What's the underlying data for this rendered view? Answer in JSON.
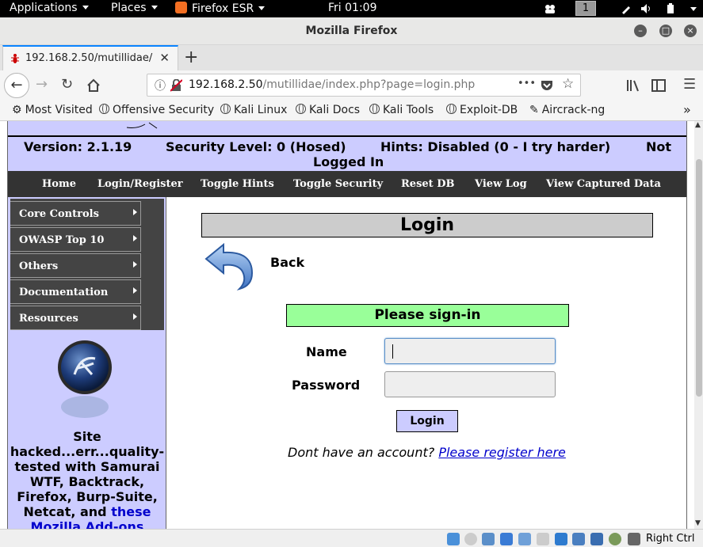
{
  "topbar": {
    "applications": "Applications",
    "places": "Places",
    "firefox": "Firefox ESR",
    "clock": "Fri 01:09",
    "workspace": "1"
  },
  "window": {
    "title": "Mozilla Firefox"
  },
  "tab": {
    "label": "192.168.2.50/mutillidae/"
  },
  "urlbar": {
    "host": "192.168.2.50",
    "path": "/mutillidae/index.php?page=login.php",
    "ellipsis": "•••"
  },
  "bookmarks": [
    "Most Visited",
    "Offensive Security",
    "Kali Linux",
    "Kali Docs",
    "Kali Tools",
    "Exploit-DB",
    "Aircrack-ng"
  ],
  "page": {
    "version": "Version: 2.1.19",
    "security": "Security Level: 0 (Hosed)",
    "hints": "Hints: Disabled (0 - I try harder)",
    "not": "Not",
    "logged_in": "Logged In",
    "menu": [
      "Home",
      "Login/Register",
      "Toggle Hints",
      "Toggle Security",
      "Reset DB",
      "View Log",
      "View Captured Data"
    ],
    "side_menu": [
      "Core Controls",
      "OWASP Top 10",
      "Others",
      "Documentation",
      "Resources"
    ],
    "side_text": [
      "Site",
      "hacked...err...quality-",
      "tested with Samurai",
      "WTF, Backtrack,",
      "Firefox, Burp-Suite,",
      "Netcat, and "
    ],
    "side_link": "these",
    "side_link2": "Mozilla Add-ons",
    "login_title": "Login",
    "back": "Back",
    "signin": "Please sign-in",
    "name_label": "Name",
    "password_label": "Password",
    "login_button": "Login",
    "register_prompt": "Dont have an account? ",
    "register_link": "Please register here"
  },
  "statusbar": {
    "host_key": "Right Ctrl"
  },
  "colors": {
    "lavender": "#ccccff",
    "green": "#99ff99",
    "menu": "#333333",
    "link": "#0000cc"
  }
}
